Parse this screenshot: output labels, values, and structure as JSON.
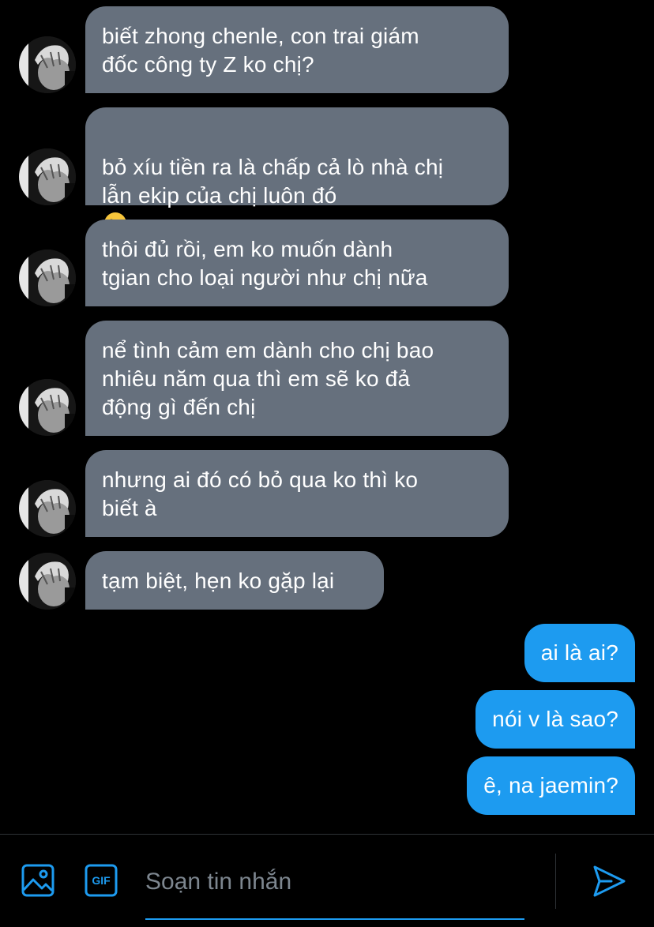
{
  "thread": {
    "incoming": [
      {
        "text": "biết zhong chenle, con trai giám\nđốc công ty Z ko chị?"
      },
      {
        "text": "bỏ xíu tiền ra là chấp cả lò nhà chị\nlẫn ekip của chị luôn đó",
        "emoji": "kissing-face-emoji"
      },
      {
        "text": "thôi đủ rồi, em ko muốn dành\ntgian cho loại người như chị nữa"
      },
      {
        "text": "nể tình cảm em dành cho chị bao\nnhiêu năm qua thì em sẽ ko đả\nđộng gì đến chị"
      },
      {
        "text": "nhưng ai đó có bỏ qua ko thì ko\nbiết à"
      },
      {
        "text": "tạm biệt, hẹn ko gặp lại"
      }
    ],
    "outgoing": [
      {
        "text": "ai là ai?"
      },
      {
        "text": "nói v là sao?"
      },
      {
        "text": "ê, na jaemin?"
      }
    ]
  },
  "composer": {
    "placeholder": "Soạn tin nhắn",
    "gif_label": "GIF",
    "media_icon": "image-icon",
    "send_icon": "send-icon"
  },
  "colors": {
    "background": "#000000",
    "incoming_bubble": "#66707d",
    "outgoing_bubble": "#1d9bf0",
    "accent": "#1d9bf0",
    "placeholder": "#7d868f"
  }
}
